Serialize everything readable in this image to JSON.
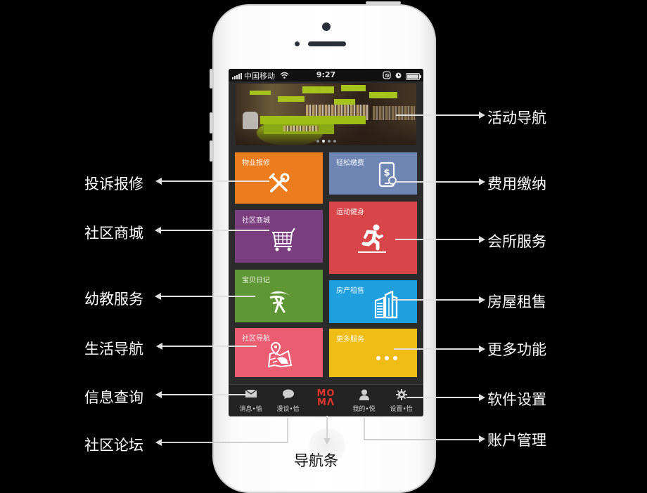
{
  "status_bar": {
    "carrier": "中国移动",
    "time": "9:27",
    "icons": [
      "signal-icon",
      "wifi-icon",
      "rotation-lock-icon",
      "alarm-icon",
      "battery-icon"
    ]
  },
  "banner": {
    "description": "Activity banner photo (bookstore interior)",
    "page_dots": 4,
    "active_dot": 1
  },
  "tiles": [
    {
      "label": "物业报修",
      "icon": "tools-icon",
      "color": "#ec7d1f"
    },
    {
      "label": "轻松缴费",
      "icon": "mobile-payment-icon",
      "color": "#6f86b4"
    },
    {
      "label": "社区商城",
      "icon": "shopping-cart-icon",
      "color": "#7a3e7f"
    },
    {
      "label": "运动健身",
      "icon": "running-man-icon",
      "color": "#d8464a"
    },
    {
      "label": "宝贝日记",
      "icon": "diary-leaf-icon",
      "color": "#5f9734"
    },
    {
      "label": "房产租售",
      "icon": "building-icon",
      "color": "#1f9fde"
    },
    {
      "label": "社区导航",
      "icon": "map-pin-icon",
      "color": "#ec5d72"
    },
    {
      "label": "更多服务",
      "icon": "more-dots-icon",
      "color": "#f0bd17"
    }
  ],
  "tab_bar": {
    "tabs": [
      {
        "label": "消息•愉",
        "icon": "envelope-icon"
      },
      {
        "label": "漫谈•恰",
        "icon": "chat-bubble-icon"
      },
      {
        "label": "",
        "icon": "moma-logo",
        "logo_line1": "MO",
        "logo_line2": "MΛ"
      },
      {
        "label": "我的•悦",
        "icon": "user-icon"
      },
      {
        "label": "设置•怡",
        "icon": "gear-icon"
      }
    ],
    "logo_color": "#e3342a"
  },
  "callouts": {
    "left": [
      "投诉报修",
      "社区商城",
      "幼教服务",
      "生活导航",
      "信息查询",
      "社区论坛"
    ],
    "right": [
      "活动导航",
      "费用缴纳",
      "会所服务",
      "房屋租售",
      "更多功能",
      "软件设置",
      "账户管理"
    ],
    "bottom": "导航条"
  }
}
